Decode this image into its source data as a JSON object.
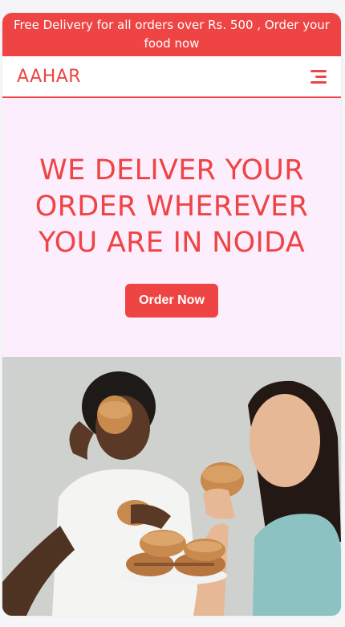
{
  "promo": {
    "text": "Free Delivery for all orders over Rs. 500 , Order your food now"
  },
  "navbar": {
    "logo": "AAHAR",
    "menu_icon": "hamburger-menu-icon"
  },
  "hero": {
    "title": "WE DELIVER YOUR ORDER WHEREVER YOU ARE IN NOIDA",
    "cta_label": "Order Now"
  },
  "colors": {
    "accent": "#ef4444",
    "hero_bg": "#fdeefe",
    "white": "#ffffff"
  }
}
